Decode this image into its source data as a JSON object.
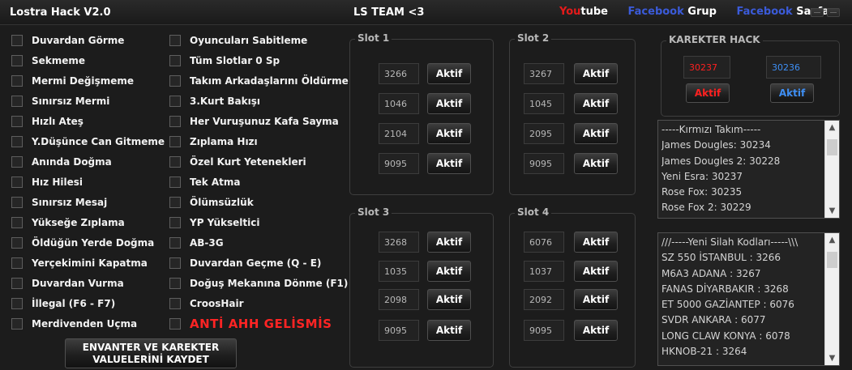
{
  "window": {
    "title": "Lostra Hack V2.0",
    "team": "LS TEAM <3",
    "links": {
      "youtube_red": "You",
      "youtube_white": "tube",
      "facebook1": "Facebook",
      "grup": " Grup",
      "facebook2": "Facebook",
      "sayfa": " Sayfa"
    }
  },
  "colors": {
    "background": "#1c1c1c",
    "red_accent": "#ff2020",
    "blue_accent": "#3e8ff5",
    "facebook_blue": "#3b5bd9",
    "youtube_red": "#e51a1a"
  },
  "left_column": [
    "Duvardan Görme",
    "Sekmeme",
    "Mermi Değişmeme",
    "Sınırsız Mermi",
    "Hızlı Ateş",
    "Y.Düşünce Can Gitmeme",
    "Anında Doğma",
    "Hız Hilesi",
    "Sınırsız Mesaj",
    "Yükseğe Zıplama",
    "Öldüğün Yerde Doğma",
    "Yerçekimini Kapatma",
    "Duvardan Vurma",
    "İllegal (F6 - F7)",
    "Merdivenden Uçma"
  ],
  "right_column": [
    "Oyuncuları Sabitleme",
    "Tüm Slotlar 0 Sp",
    "Takım Arkadaşlarını Öldürme",
    "3.Kurt Bakışı",
    "Her Vuruşunuz Kafa Sayma",
    "Zıplama Hızı",
    "Özel Kurt Yetenekleri",
    "Tek Atma",
    "Ölümsüzlük",
    "YP Yükseltici",
    "AB-3G",
    "Duvardan Geçme (Q - E)",
    "Doğuş Mekanına Dönme (F1)",
    "CroosHair",
    "ANTİ AHH GELİSMİS"
  ],
  "save_button": {
    "line1": "ENVANTER VE KAREKTER",
    "line2": "VALUELERİNİ KAYDET"
  },
  "slots": [
    {
      "title": "Slot 1",
      "values": [
        "3266",
        "1046",
        "2104",
        "9095"
      ]
    },
    {
      "title": "Slot 2",
      "values": [
        "3267",
        "1045",
        "2095",
        "9095"
      ]
    },
    {
      "title": "Slot 3",
      "values": [
        "3268",
        "1035",
        "2098",
        "9095"
      ]
    },
    {
      "title": "Slot 4",
      "values": [
        "6076",
        "1037",
        "2092",
        "9095"
      ]
    }
  ],
  "aktif_label": "Aktif",
  "karekter_hack": {
    "title": "KAREKTER HACK",
    "red_value": "30237",
    "blue_value": "30236",
    "red_button": "Aktif",
    "blue_button": "Aktif"
  },
  "team_list": [
    "-----Kırmızı Takım-----",
    "James Dougles: 30234",
    "James Dougles 2: 30228",
    "Yeni Esra: 30237",
    "Rose Fox: 30235",
    "Rose Fox 2: 30229"
  ],
  "weapon_list": [
    "///-----Yeni Silah Kodları-----\\\\\\",
    "SZ 550 İSTANBUL : 3266",
    "M6A3 ADANA : 3267",
    "FANAS DİYARBAKIR : 3268",
    "ET 5000 GAZİANTEP : 6076",
    "SVDR ANKARA : 6077",
    "LONG CLAW KONYA : 6078",
    "HKNOB-21 : 3264"
  ]
}
